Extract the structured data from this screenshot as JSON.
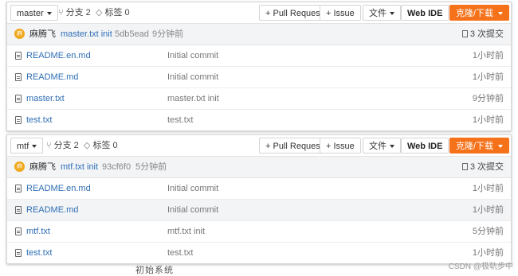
{
  "panels": [
    {
      "branch": "master",
      "branches_label": "分支 2",
      "tags_label": "标签 0",
      "buttons": {
        "pull_request": "+ Pull Request",
        "issue": "+ Issue",
        "file": "文件",
        "web_ide": "Web IDE",
        "clone": "克隆/下载"
      },
      "commit": {
        "avatar": "麻",
        "author": "麻腾飞",
        "message": "master.txt init",
        "hash": "5db5ead",
        "time": "9分钟前",
        "count": "3 次提交"
      },
      "files": [
        {
          "name": "README.en.md",
          "message": "Initial commit",
          "time": "1小时前",
          "highlight": false
        },
        {
          "name": "README.md",
          "message": "Initial commit",
          "time": "1小时前",
          "highlight": false
        },
        {
          "name": "master.txt",
          "message": "master.txt init",
          "time": "9分钟前",
          "highlight": false
        },
        {
          "name": "test.txt",
          "message": "test.txt",
          "time": "1小时前",
          "highlight": false
        }
      ]
    },
    {
      "branch": "mtf",
      "branches_label": "分支 2",
      "tags_label": "标签 0",
      "buttons": {
        "pull_request": "+ Pull Request",
        "issue": "+ Issue",
        "file": "文件",
        "web_ide": "Web IDE",
        "clone": "克隆/下载"
      },
      "commit": {
        "avatar": "麻",
        "author": "麻腾飞",
        "message": "mtf.txt init",
        "hash": "93cf6f0",
        "time": "5分钟前",
        "count": "3 次提交"
      },
      "files": [
        {
          "name": "README.en.md",
          "message": "Initial commit",
          "time": "1小时前",
          "highlight": false
        },
        {
          "name": "README.md",
          "message": "Initial commit",
          "time": "1小时前",
          "highlight": true
        },
        {
          "name": "mtf.txt",
          "message": "mtf.txt init",
          "time": "5分钟前",
          "highlight": false
        },
        {
          "name": "test.txt",
          "message": "test.txt",
          "time": "1小时前",
          "highlight": false
        }
      ]
    }
  ],
  "behind_text": "初始系统",
  "watermark": "CSDN @极轨步中",
  "colors": {
    "accent_orange": "#f5721b",
    "link_blue": "#2f6fb6",
    "avatar_yellow": "#f0a81c"
  }
}
